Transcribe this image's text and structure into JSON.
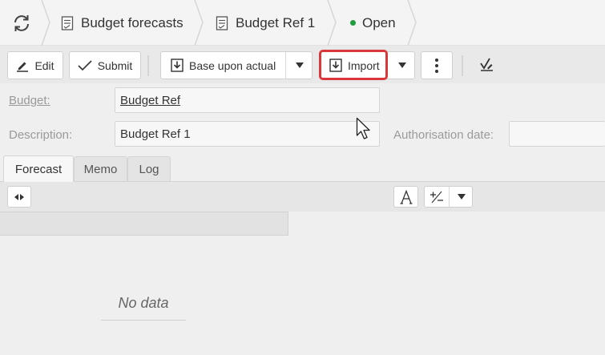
{
  "breadcrumbs": [
    {
      "label": "Budget forecasts",
      "icon": "document-icon"
    },
    {
      "label": "Budget Ref 1",
      "icon": "document-icon"
    },
    {
      "label": "Open",
      "status_color": "#1e9e3e"
    }
  ],
  "toolbar": {
    "edit_label": "Edit",
    "submit_label": "Submit",
    "base_upon_actual_label": "Base upon actual",
    "import_label": "Import",
    "highlight_color": "#d9373b"
  },
  "form": {
    "budget_label": "Budget:",
    "budget_value": "Budget Ref",
    "description_label": "Description:",
    "description_value": "Budget Ref 1",
    "authorisation_date_label": "Authorisation date:",
    "authorisation_date_value": ""
  },
  "tabs": [
    {
      "label": "Forecast",
      "active": true
    },
    {
      "label": "Memo",
      "active": false
    },
    {
      "label": "Log",
      "active": false
    }
  ],
  "grid": {
    "empty_text": "No data"
  }
}
